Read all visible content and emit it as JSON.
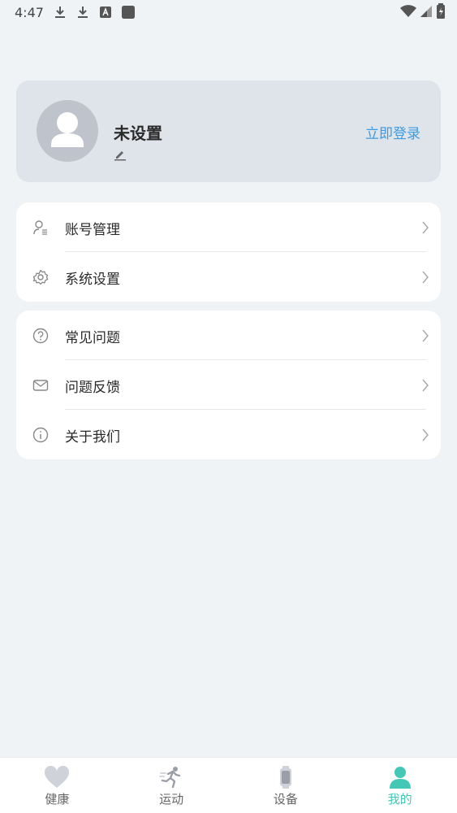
{
  "status_bar": {
    "time": "4:47"
  },
  "profile": {
    "name": "未设置",
    "login_label": "立即登录"
  },
  "menu_group_1": [
    {
      "label": "账号管理",
      "icon": "account-icon"
    },
    {
      "label": "系统设置",
      "icon": "gear-icon"
    }
  ],
  "menu_group_2": [
    {
      "label": "常见问题",
      "icon": "question-icon"
    },
    {
      "label": "问题反馈",
      "icon": "mail-icon"
    },
    {
      "label": "关于我们",
      "icon": "info-icon"
    }
  ],
  "tabs": [
    {
      "label": "健康",
      "icon": "heart-icon"
    },
    {
      "label": "运动",
      "icon": "running-icon"
    },
    {
      "label": "设备",
      "icon": "watch-icon"
    },
    {
      "label": "我的",
      "icon": "user-icon",
      "active": true
    }
  ],
  "colors": {
    "accent": "#43c8b6",
    "link": "#3d9be0",
    "background": "#f0f3f6",
    "profile_card": "#dfe3ea"
  }
}
